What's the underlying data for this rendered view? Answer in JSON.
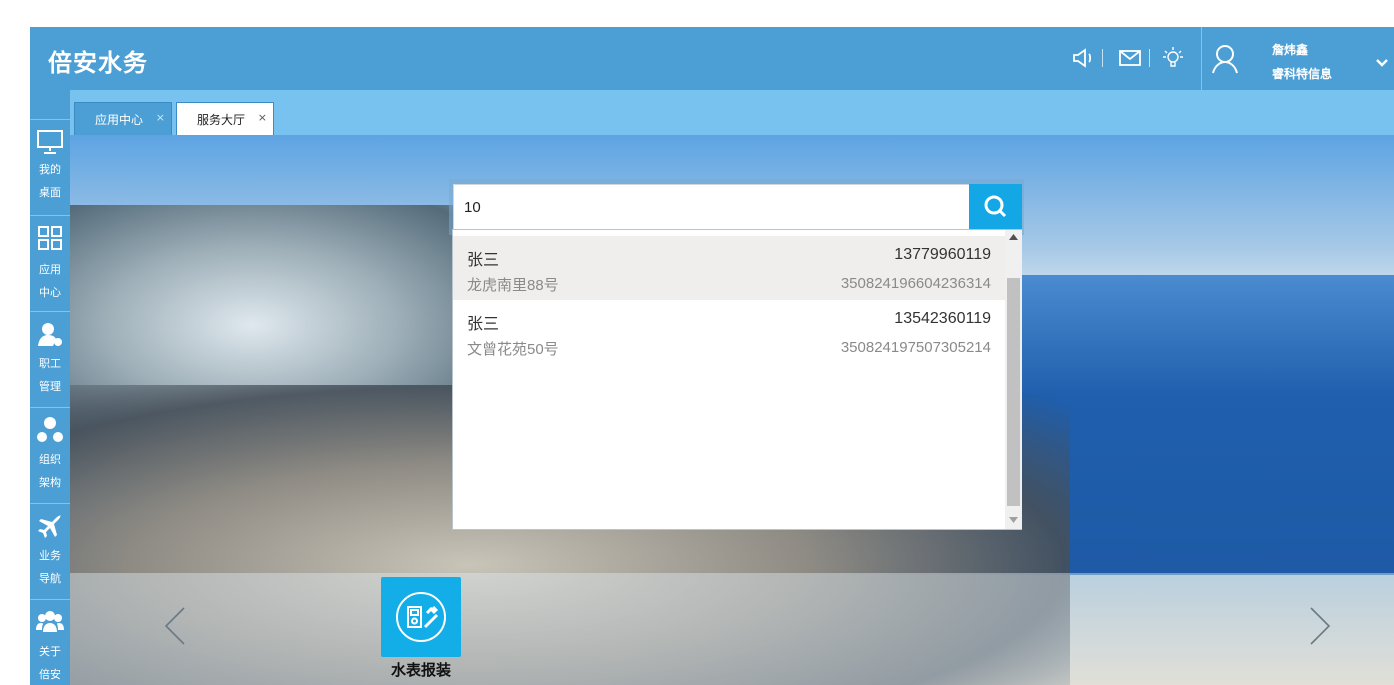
{
  "header": {
    "title": "倍安水务",
    "icons": [
      "megaphone-icon",
      "mail-icon",
      "lightbulb-icon",
      "user-icon",
      "chevron-down-icon"
    ],
    "user_name": "詹炜鑫",
    "user_org": "睿科特信息"
  },
  "sidebar": {
    "items": [
      {
        "icon": "monitor-icon",
        "line1": "我的",
        "line2": "桌面"
      },
      {
        "icon": "grid-icon",
        "line1": "应用",
        "line2": "中心"
      },
      {
        "icon": "staff-settings-icon",
        "line1": "职工",
        "line2": "管理"
      },
      {
        "icon": "org-chart-icon",
        "line1": "组织",
        "line2": "架构"
      },
      {
        "icon": "airplane-icon",
        "line1": "业务",
        "line2": "导航"
      },
      {
        "icon": "group-icon",
        "line1": "关于",
        "line2": "倍安"
      }
    ]
  },
  "tabs": [
    {
      "label": "应用中心",
      "close": "×",
      "active": false
    },
    {
      "label": "服务大厅",
      "close": "×",
      "active": true
    }
  ],
  "search": {
    "value": "10",
    "results": [
      {
        "name": "张三",
        "phone": "13779960119",
        "address": "龙虎南里88号",
        "id_number": "350824196604236314",
        "highlighted": true
      },
      {
        "name": "张三",
        "phone": "13542360119",
        "address": "文曾花苑50号",
        "id_number": "350824197507305214",
        "highlighted": false
      }
    ]
  },
  "carousel": {
    "tiles": [
      {
        "icon": "meter-repair-icon",
        "label": "水表报装"
      }
    ]
  },
  "colors": {
    "header_bg": "#4c9fd4",
    "tabbar_bg": "#77c2ee",
    "accent": "#13a7e6",
    "highlight_row": "#f0eeec"
  }
}
